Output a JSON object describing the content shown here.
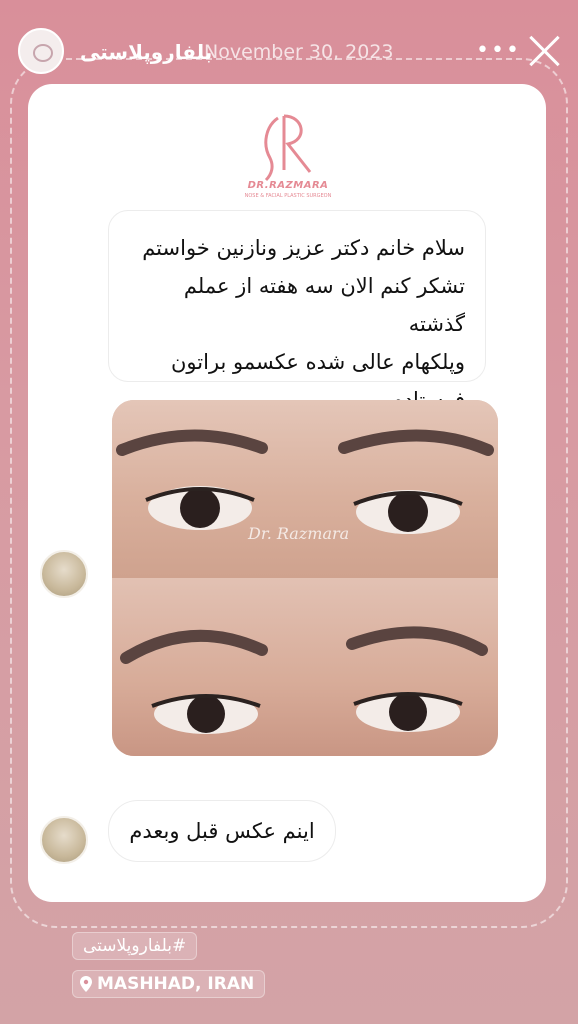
{
  "header": {
    "username": "بلفاروپلاستی",
    "date": "November 30, 2023",
    "more_label": "•••"
  },
  "logo": {
    "brand": "DR.RAZMARA",
    "tagline": "NOSE & FACIAL PLASTIC SURGEON"
  },
  "messages": [
    {
      "lines": [
        "سلام خانم دکتر عزیز ونازنین خواستم",
        "تشکر کنم الان سه هفته از عملم گذشته",
        "وپلکهام عالی شده عکسمو براتون",
        "فرستادم ."
      ]
    },
    {
      "text": "اینم عکس قبل وبعدم"
    }
  ],
  "photo": {
    "watermark": "Dr. Razmara"
  },
  "stickers": {
    "hashtag": "#بلفاروپلاستی",
    "location": "MASHHAD, IRAN"
  },
  "colors": {
    "background": "#d98f9a",
    "brand": "#e58a94"
  }
}
